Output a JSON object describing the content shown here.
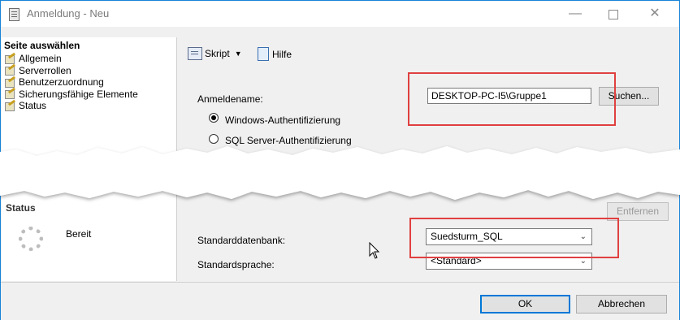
{
  "window": {
    "title": "Anmeldung - Neu"
  },
  "left": {
    "heading": "Seite auswählen",
    "pages": [
      "Allgemein",
      "Serverrollen",
      "Benutzerzuordnung",
      "Sicherungsfähige Elemente",
      "Status"
    ],
    "status_heading": "Status",
    "status_text": "Bereit"
  },
  "toolbar": {
    "script_label": "Skript",
    "help_label": "Hilfe"
  },
  "form": {
    "login_name_label": "Anmeldename:",
    "login_name_value": "DESKTOP-PC-I5\\Gruppe1",
    "search_button": "Suchen...",
    "auth_windows": "Windows-Authentifizierung",
    "auth_sql": "SQL Server-Authentifizierung",
    "remove_button": "Entfernen",
    "default_db_label": "Standarddatenbank:",
    "default_db_value": "Suedsturm_SQL",
    "default_lang_label": "Standardsprache:",
    "default_lang_value": "<Standard>"
  },
  "footer": {
    "ok_button": "OK",
    "cancel_button": "Abbrechen"
  },
  "colors": {
    "highlight": "#e04040",
    "accent": "#0078d7"
  }
}
